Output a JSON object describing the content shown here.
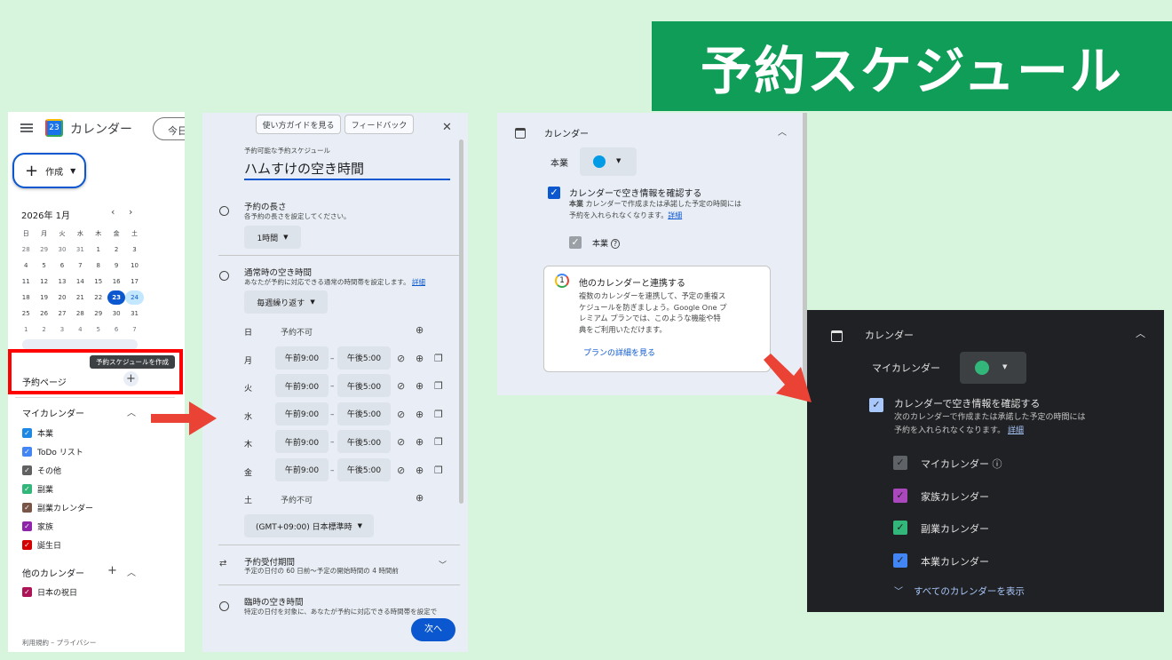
{
  "banner": {
    "title": "予約スケジュール"
  },
  "panel1": {
    "app_title": "カレンダー",
    "calendar_icon_day": "23",
    "today_button": "今日",
    "create_button": "作成",
    "month_label": "2026年 1月",
    "weekdays": [
      "日",
      "月",
      "火",
      "水",
      "木",
      "金",
      "土"
    ],
    "weeks": [
      [
        "28",
        "29",
        "30",
        "31",
        "1",
        "2",
        "3"
      ],
      [
        "4",
        "5",
        "6",
        "7",
        "8",
        "9",
        "10"
      ],
      [
        "11",
        "12",
        "13",
        "14",
        "15",
        "16",
        "17"
      ],
      [
        "18",
        "19",
        "20",
        "21",
        "22",
        "23",
        "24"
      ],
      [
        "25",
        "26",
        "27",
        "28",
        "29",
        "30",
        "31"
      ],
      [
        "1",
        "2",
        "3",
        "4",
        "5",
        "6",
        "7"
      ]
    ],
    "today_date": "23",
    "selected_date": "24",
    "tooltip": "予約スケジュールを作成",
    "booking_pages": "予約ページ",
    "my_calendars_header": "マイカレンダー",
    "my_calendars": [
      {
        "label": "本業",
        "color": "#1e88e5"
      },
      {
        "label": "ToDo リスト",
        "color": "#4285f4"
      },
      {
        "label": "その他",
        "color": "#616161"
      },
      {
        "label": "副業",
        "color": "#33b679"
      },
      {
        "label": "副業カレンダー",
        "color": "#795548"
      },
      {
        "label": "家族",
        "color": "#8e24aa"
      },
      {
        "label": "誕生日",
        "color": "#d50000"
      }
    ],
    "other_calendars_header": "他のカレンダー",
    "other_calendars": [
      {
        "label": "日本の祝日",
        "color": "#ad1457"
      }
    ],
    "footer": "利用規約 – プライバシー"
  },
  "panel2": {
    "guide_button": "使い方ガイドを見る",
    "feedback_button": "フィードバック",
    "schedule_label": "予約可能な予約スケジュール",
    "schedule_title": "ハムすけの空き時間",
    "duration_title": "予約の長さ",
    "duration_desc": "各予約の長さを設定してください。",
    "duration_value": "1時間",
    "availability_title": "通常時の空き時間",
    "availability_desc": "あなたが予約に対応できる通常の時間帯を設定します。",
    "details_link": "詳細",
    "repeat_value": "毎週繰り返す",
    "unavailable": "予約不可",
    "days": [
      {
        "day": "日",
        "start": "",
        "end": ""
      },
      {
        "day": "月",
        "start": "午前9:00",
        "end": "午後5:00"
      },
      {
        "day": "火",
        "start": "午前9:00",
        "end": "午後5:00"
      },
      {
        "day": "水",
        "start": "午前9:00",
        "end": "午後5:00"
      },
      {
        "day": "木",
        "start": "午前9:00",
        "end": "午後5:00"
      },
      {
        "day": "金",
        "start": "午前9:00",
        "end": "午後5:00"
      },
      {
        "day": "土",
        "start": "",
        "end": ""
      }
    ],
    "range_dash": "–",
    "timezone": "(GMT+09:00) 日本標準時",
    "booking_window_title": "予約受付期間",
    "booking_window_desc": "予定の日付の 60 日前〜予定の開始時間の 4 時間前",
    "temp_title": "臨時の空き時間",
    "temp_desc": "特定の日付を対象に、あなたが予約に対応できる時間帯を設定で",
    "next_button": "次へ"
  },
  "panel3": {
    "section": "カレンダー",
    "calendar_name": "本業",
    "calendar_color": "#039be5",
    "check_title": "カレンダーで空き情報を確認する",
    "check_desc_bold": "本業",
    "check_desc_1": " カレンダーで作成または承諾した予定の時間には",
    "check_desc_2": "予約を入れられなくなります。",
    "details_link": "詳細",
    "sub_calendar": "本業",
    "card_title": "他のカレンダーと連携する",
    "card_lines": [
      "複数のカレンダーを連携して、予定の重複ス",
      "ケジュールを防ぎましょう。Google One プ",
      "レミアム プランでは、このような機能や特",
      "典をご利用いただけます。"
    ],
    "card_link": "プランの詳細を見る"
  },
  "panel4": {
    "section": "カレンダー",
    "calendar_name": "マイカレンダー",
    "calendar_color": "#33b679",
    "check_title": "カレンダーで空き情報を確認する",
    "check_desc_1": "次のカレンダーで作成または承諾した予定の時間には",
    "check_desc_2": "予約を入れられなくなります。",
    "details_link": "詳細",
    "calendars": [
      {
        "label": "マイカレンダー",
        "color": "#5f6368"
      },
      {
        "label": "家族カレンダー",
        "color": "#ab47bc"
      },
      {
        "label": "副業カレンダー",
        "color": "#33b679"
      },
      {
        "label": "本業カレンダー",
        "color": "#4285f4"
      }
    ],
    "show_all": "すべてのカレンダーを表示"
  }
}
